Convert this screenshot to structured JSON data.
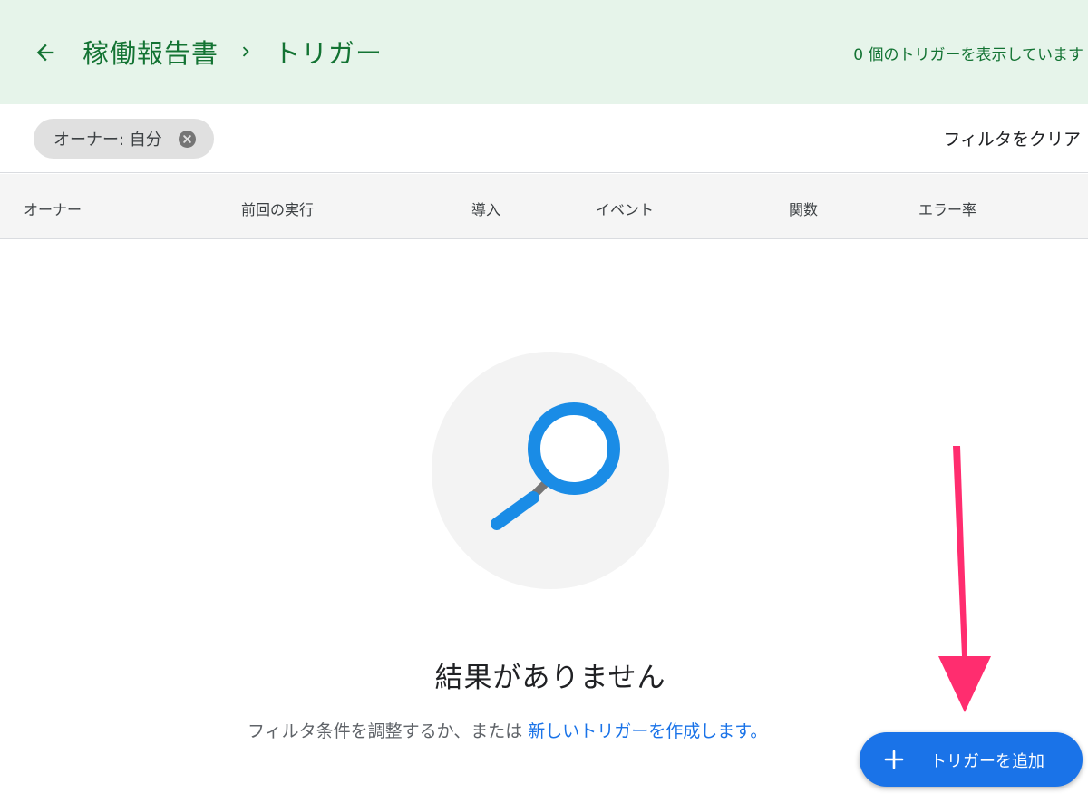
{
  "header": {
    "breadcrumb_parent": "稼働報告書",
    "breadcrumb_current": "トリガー",
    "trigger_count_text": "0 個のトリガーを表示しています",
    "accent_color": "#137333",
    "background_color": "#e6f4ea"
  },
  "filters": {
    "owner_chip_label": "オーナー: 自分",
    "clear_label": "フィルタをクリア"
  },
  "table": {
    "columns": [
      "オーナー",
      "前回の実行",
      "導入",
      "イベント",
      "関数",
      "エラー率"
    ]
  },
  "empty_state": {
    "title": "結果がありません",
    "description_prefix": "フィルタ条件を調整するか、または",
    "description_link": "新しいトリガーを作成します。",
    "icon": "magnifier-icon",
    "icon_color": "#1a8ce6"
  },
  "fab": {
    "label": "トリガーを追加",
    "icon": "plus-icon",
    "color": "#1a73e8"
  },
  "annotation": {
    "arrow_color": "#ff2d6f"
  }
}
